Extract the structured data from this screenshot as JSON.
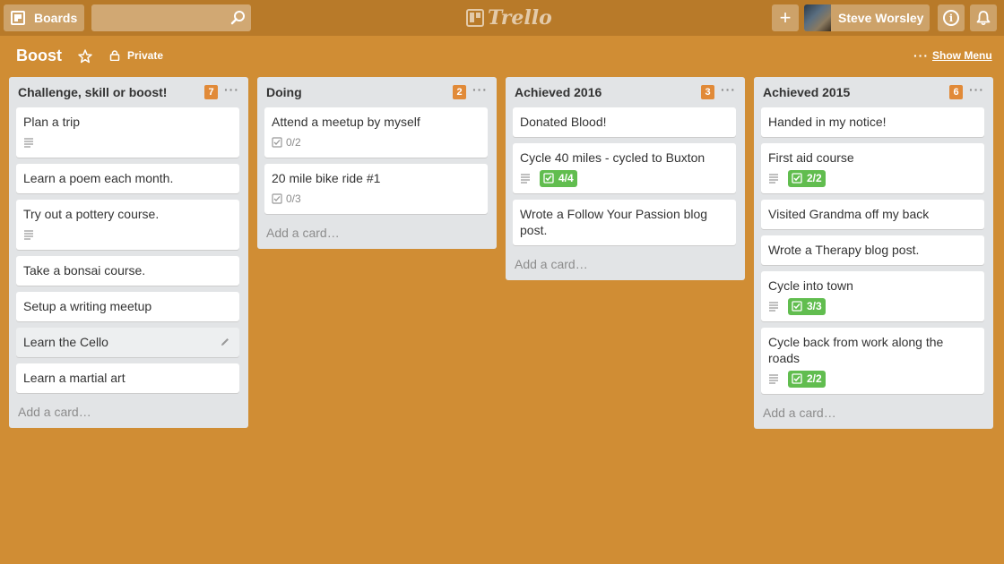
{
  "header": {
    "boards_label": "Boards",
    "search_placeholder": "",
    "logo_text": "Trello",
    "add_label": "+",
    "user_name": "Steve Worsley",
    "info_label": "i"
  },
  "board": {
    "title": "Boost",
    "visibility": "Private",
    "show_menu_label": "Show Menu",
    "menu_dots": "···"
  },
  "colors": {
    "background": "#d08d34",
    "header": "#b87a29",
    "list": "#e2e4e6",
    "count_badge": "#e18a38",
    "checklist_complete": "#61bd4f"
  },
  "add_card_label": "Add a card…",
  "lists": [
    {
      "title": "Challenge, skill or boost!",
      "count": "7",
      "cards": [
        {
          "title": "Plan a trip"
        },
        {
          "title": "Learn a poem each month."
        },
        {
          "title": "Try out a pottery course."
        },
        {
          "title": "Take a bonsai course."
        },
        {
          "title": "Setup a writing meetup"
        },
        {
          "title": "Learn the Cello"
        },
        {
          "title": "Learn a martial art"
        }
      ]
    },
    {
      "title": "Doing",
      "count": "2",
      "cards": [
        {
          "title": "Attend a meetup by myself",
          "checklist": "0/2"
        },
        {
          "title": "20 mile bike ride #1",
          "checklist": "0/3"
        }
      ]
    },
    {
      "title": "Achieved 2016",
      "count": "3",
      "cards": [
        {
          "title": "Donated Blood!"
        },
        {
          "title": "Cycle 40 miles - cycled to Buxton",
          "checklist": "4/4"
        },
        {
          "title": "Wrote a Follow Your Passion blog post."
        }
      ]
    },
    {
      "title": "Achieved 2015",
      "count": "6",
      "cards": [
        {
          "title": "Handed in my notice!"
        },
        {
          "title": "First aid course",
          "checklist": "2/2"
        },
        {
          "title": "Visited Grandma off my back"
        },
        {
          "title": "Wrote a Therapy blog post."
        },
        {
          "title": "Cycle into town",
          "checklist": "3/3"
        },
        {
          "title": "Cycle back from work along the roads",
          "checklist": "2/2"
        }
      ]
    }
  ]
}
